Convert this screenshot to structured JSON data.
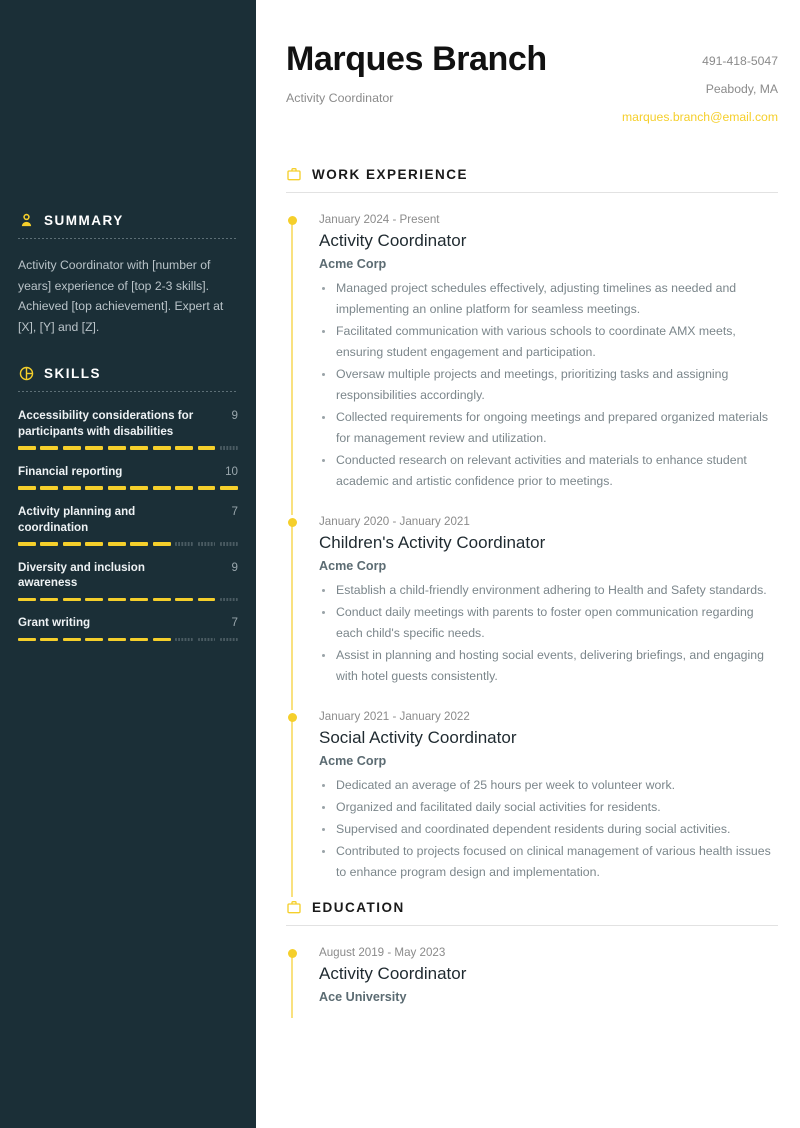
{
  "theme": {
    "accent": "#f5cf2b",
    "sidebar_bg": "#1b2f37",
    "page_bg": "#ffffff",
    "muted_text": "#8b8b8b"
  },
  "header": {
    "name": "Marques Branch",
    "job_title": "Activity Coordinator",
    "phone": "491-418-5047",
    "location": "Peabody, MA",
    "email": "marques.branch@email.com"
  },
  "sidebar": {
    "summary": {
      "icon": "person-icon",
      "title": "SUMMARY",
      "text": "Activity Coordinator with [number of years] experience of [top 2-3 skills]. Achieved [top achievement]. Expert at [X], [Y] and [Z]."
    },
    "skills": {
      "icon": "chart-circle-icon",
      "title": "SKILLS",
      "max": 10,
      "items": [
        {
          "name": "Accessibility considerations for participants with disabilities",
          "score": 9
        },
        {
          "name": "Financial reporting",
          "score": 10
        },
        {
          "name": "Activity planning and coordination",
          "score": 7
        },
        {
          "name": "Diversity and inclusion awareness",
          "score": 9
        },
        {
          "name": "Grant writing",
          "score": 7
        }
      ]
    }
  },
  "main": {
    "work": {
      "icon": "briefcase-icon",
      "title": "WORK EXPERIENCE",
      "entries": [
        {
          "date": "January 2024 - Present",
          "role": "Activity Coordinator",
          "org": "Acme Corp",
          "bullets": [
            "Managed project schedules effectively, adjusting timelines as needed and implementing an online platform for seamless meetings.",
            "Facilitated communication with various schools to coordinate AMX meets, ensuring student engagement and participation.",
            "Oversaw multiple projects and meetings, prioritizing tasks and assigning responsibilities accordingly.",
            "Collected requirements for ongoing meetings and prepared organized materials for management review and utilization.",
            "Conducted research on relevant activities and materials to enhance student academic and artistic confidence prior to meetings."
          ]
        },
        {
          "date": "January 2020 - January 2021",
          "role": "Children's Activity Coordinator",
          "org": "Acme Corp",
          "bullets": [
            "Establish a child-friendly environment adhering to Health and Safety standards.",
            "Conduct daily meetings with parents to foster open communication regarding each child's specific needs.",
            "Assist in planning and hosting social events, delivering briefings, and engaging with hotel guests consistently."
          ]
        },
        {
          "date": "January 2021 - January 2022",
          "role": "Social Activity Coordinator",
          "org": "Acme Corp",
          "bullets": [
            "Dedicated an average of 25 hours per week to volunteer work.",
            "Organized and facilitated daily social activities for residents.",
            "Supervised and coordinated dependent residents during social activities.",
            "Contributed to projects focused on clinical management of various health issues to enhance program design and implementation."
          ]
        }
      ]
    },
    "education": {
      "icon": "briefcase-icon",
      "title": "EDUCATION",
      "entries": [
        {
          "date": "August 2019 - May 2023",
          "role": "Activity Coordinator",
          "org": "Ace University",
          "bullets": []
        }
      ]
    }
  }
}
